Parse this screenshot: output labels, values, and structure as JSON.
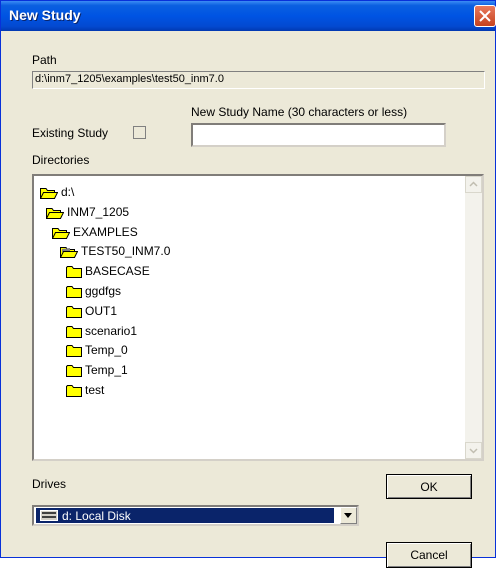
{
  "window": {
    "title": "New Study"
  },
  "path": {
    "label": "Path",
    "value": "d:\\inm7_1205\\examples\\test50_inm7.0"
  },
  "study_name": {
    "label": "New Study Name (30 characters or less)",
    "value": ""
  },
  "existing_study": {
    "label": "Existing Study",
    "checked": false
  },
  "directories": {
    "label": "Directories",
    "items": [
      {
        "label": "d:\\",
        "level": 0,
        "state": "open"
      },
      {
        "label": "INM7_1205",
        "level": 1,
        "state": "open"
      },
      {
        "label": "EXAMPLES",
        "level": 2,
        "state": "open"
      },
      {
        "label": "TEST50_INM7.0",
        "level": 3,
        "state": "current"
      },
      {
        "label": "BASECASE",
        "level": 4,
        "state": "closed"
      },
      {
        "label": "ggdfgs",
        "level": 4,
        "state": "closed"
      },
      {
        "label": "OUT1",
        "level": 4,
        "state": "closed"
      },
      {
        "label": "scenario1",
        "level": 4,
        "state": "closed"
      },
      {
        "label": "Temp_0",
        "level": 4,
        "state": "closed"
      },
      {
        "label": "Temp_1",
        "level": 4,
        "state": "closed"
      },
      {
        "label": "test",
        "level": 4,
        "state": "closed"
      }
    ]
  },
  "drives": {
    "label": "Drives",
    "selected": "d: Local Disk"
  },
  "buttons": {
    "ok": "OK",
    "cancel": "Cancel"
  }
}
